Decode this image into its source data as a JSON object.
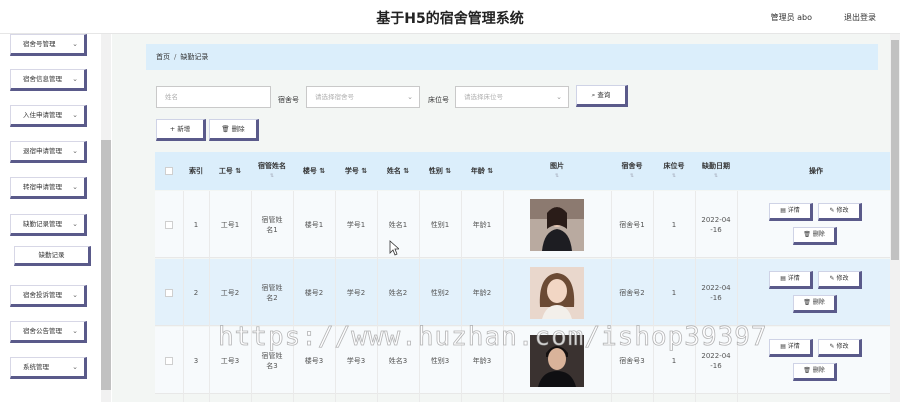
{
  "app_title": "基于H5的宿舍管理系统",
  "user_info": "管理员 abo",
  "logout_label": "退出登录",
  "sidebar": {
    "items": [
      {
        "label": "宿舍号管理"
      },
      {
        "label": "宿舍信息管理"
      },
      {
        "label": "入住申请管理"
      },
      {
        "label": "退宿申请管理"
      },
      {
        "label": "转宿申请管理"
      },
      {
        "label": "缺勤记录管理"
      },
      {
        "label": "缺勤记录"
      },
      {
        "label": "宿舍投诉管理"
      },
      {
        "label": "宿舍公告管理"
      },
      {
        "label": "系统管理"
      }
    ]
  },
  "breadcrumb": {
    "home": "首页",
    "sep": "/",
    "current": "缺勤记录"
  },
  "search": {
    "name_placeholder": "姓名",
    "dorm_label": "宿舍号",
    "dorm_placeholder": "请选择宿舍号",
    "bed_label": "床位号",
    "bed_placeholder": "请选择床位号",
    "query_label": "查询"
  },
  "toolbar": {
    "add_label": "新增",
    "delete_label": "删除"
  },
  "table": {
    "headers": [
      "索引",
      "工号",
      "宿管姓名",
      "楼号",
      "学号",
      "姓名",
      "性别",
      "年龄",
      "图片",
      "宿舍号",
      "床位号",
      "缺勤日期",
      "操作"
    ],
    "rows": [
      {
        "index": "1",
        "job": "工号1",
        "manager": "宿管姓名1",
        "building": "楼号1",
        "student_no": "学号1",
        "name": "姓名1",
        "gender": "性别1",
        "age": "年龄1",
        "dorm": "宿舍号1",
        "bed": "1",
        "date": "2022-04-16"
      },
      {
        "index": "2",
        "job": "工号2",
        "manager": "宿管姓名2",
        "building": "楼号2",
        "student_no": "学号2",
        "name": "姓名2",
        "gender": "性别2",
        "age": "年龄2",
        "dorm": "宿舍号2",
        "bed": "1",
        "date": "2022-04-16"
      },
      {
        "index": "3",
        "job": "工号3",
        "manager": "宿管姓名3",
        "building": "楼号3",
        "student_no": "学号3",
        "name": "姓名3",
        "gender": "性别3",
        "age": "年龄3",
        "dorm": "宿舍号3",
        "bed": "1",
        "date": "2022-04-16"
      }
    ],
    "actions": {
      "detail": "详情",
      "edit": "修改",
      "delete": "删除"
    }
  },
  "watermark": "https://www.huzhan.com/ishop39397",
  "colors": {
    "accent": "#5a5a8a",
    "header_bg": "#dbeefb",
    "row_alt_bg": "#e3f1fb"
  }
}
